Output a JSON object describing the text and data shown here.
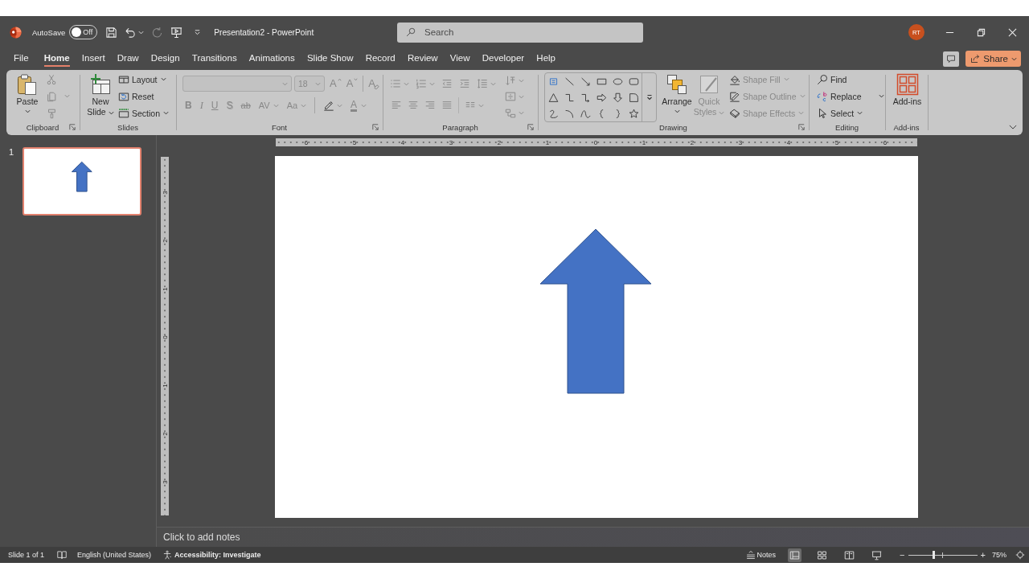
{
  "title_bar": {
    "autosave": {
      "label": "AutoSave",
      "on": false,
      "state": "Off"
    },
    "document_title": "Presentation2 - PowerPoint",
    "search": {
      "placeholder": "Search"
    },
    "account": {
      "initials": "RT"
    }
  },
  "quick_access": {
    "undo": {
      "disabled": false
    },
    "redo": {
      "disabled": true
    }
  },
  "tabs": [
    {
      "label": "File",
      "selected": false
    },
    {
      "label": "Home",
      "selected": true
    },
    {
      "label": "Insert",
      "selected": false
    },
    {
      "label": "Draw",
      "selected": false
    },
    {
      "label": "Design",
      "selected": false
    },
    {
      "label": "Transitions",
      "selected": false
    },
    {
      "label": "Animations",
      "selected": false
    },
    {
      "label": "Slide Show",
      "selected": false
    },
    {
      "label": "Record",
      "selected": false
    },
    {
      "label": "Review",
      "selected": false
    },
    {
      "label": "View",
      "selected": false
    },
    {
      "label": "Developer",
      "selected": false
    },
    {
      "label": "Help",
      "selected": false
    }
  ],
  "share": {
    "label": "Share"
  },
  "ribbon": {
    "clipboard": {
      "label": "Clipboard",
      "paste": {
        "label": "Paste",
        "disabled": false
      },
      "cut": {
        "disabled": true
      },
      "copy": {
        "disabled": true
      },
      "format_painter": {
        "disabled": true
      }
    },
    "slides": {
      "label": "Slides",
      "new_slide": {
        "label": "New Slide"
      },
      "layout": {
        "label": "Layout"
      },
      "reset": {
        "label": "Reset"
      },
      "section": {
        "label": "Section"
      }
    },
    "font": {
      "label": "Font",
      "disabled": true,
      "font_size": "18",
      "grow": "A",
      "shrink": "A",
      "clear": "A",
      "bold": "B",
      "italic": "I",
      "underline": "U",
      "shadow": "S",
      "strikethrough": "ab",
      "spacing": "AV",
      "change_case": "Aa",
      "font_color": "A"
    },
    "paragraph": {
      "label": "Paragraph",
      "disabled": true
    },
    "drawing": {
      "label": "Drawing",
      "arrange": {
        "label": "Arrange",
        "disabled": false
      },
      "quick_styles": {
        "label": "Quick Styles",
        "disabled": true
      },
      "shape_fill": {
        "label": "Shape Fill",
        "disabled": true
      },
      "shape_outline": {
        "label": "Shape Outline",
        "disabled": true
      },
      "shape_effects": {
        "label": "Shape Effects",
        "disabled": true
      }
    },
    "editing": {
      "label": "Editing",
      "find": {
        "label": "Find"
      },
      "replace": {
        "label": "Replace"
      },
      "select": {
        "label": "Select"
      }
    },
    "add_ins": {
      "label": "Add-ins",
      "add_ins_button": {
        "label": "Add-ins"
      }
    }
  },
  "slide_panel": {
    "slides": [
      {
        "number": "1",
        "selected": true
      }
    ]
  },
  "rulers": {
    "horizontal": [
      "6",
      "5",
      "4",
      "3",
      "2",
      "1",
      "0",
      "1",
      "2",
      "3",
      "4",
      "5",
      "6"
    ],
    "vertical": [
      "3",
      "2",
      "1",
      "0",
      "1",
      "2",
      "3"
    ]
  },
  "slide": {
    "shapes": [
      {
        "kind": "up_arrow"
      }
    ]
  },
  "notes": {
    "placeholder": "Click to add notes"
  },
  "status_bar": {
    "slide_counter": "Slide 1 of 1",
    "language": "English (United States)",
    "accessibility": "Accessibility: Investigate",
    "notes_button": {
      "label": "Notes"
    },
    "views": [
      {
        "kind": "normal",
        "selected": true
      },
      {
        "kind": "slide_sorter",
        "selected": false
      },
      {
        "kind": "reading",
        "selected": false
      },
      {
        "kind": "slide_show",
        "selected": false
      }
    ],
    "zoom": {
      "zoom_out": "−",
      "zoom_in": "+",
      "level": 0.37,
      "reading": "75%"
    }
  }
}
